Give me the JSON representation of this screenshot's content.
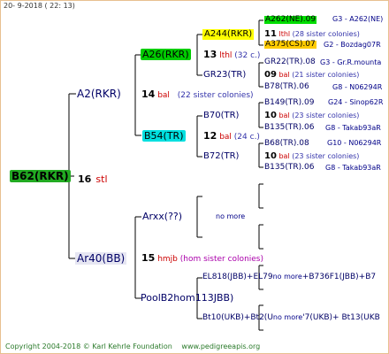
{
  "header": {
    "date": "20-  9-2018 (  22:  13)"
  },
  "footer": {
    "copyright": "Copyright 2004-2018 © Karl Kehrle Foundation",
    "url": "www.pedigreeapis.org"
  },
  "root": {
    "name": "B62(RKR)",
    "num": "16",
    "label": "stl"
  },
  "sire": {
    "name": "A2(RKR)",
    "num": "14",
    "label": "bal",
    "note": "(22 sister colonies)"
  },
  "dam": {
    "name": "Ar40(BB)",
    "num": "15",
    "label": "hmjb",
    "note": "(hom sister colonies)"
  },
  "s_a26": {
    "name": "A26(RKR)",
    "num": "13",
    "label": "lthl",
    "note": "(32 c.)"
  },
  "s_b54": {
    "name": "B54(TR)",
    "num": "12",
    "label": "bal",
    "note": "(24 c.)"
  },
  "d_arxx": {
    "name": "Arxx(??)",
    "note": "no more"
  },
  "d_pool": {
    "name": "PoolB2hom113JBB)"
  },
  "a244": {
    "name": "A244(RKR)",
    "num": "11",
    "label": "lthl",
    "note": "(28 sister colonies)"
  },
  "gr23": {
    "name": "GR23(TR)",
    "num": "09",
    "label": "bal",
    "note": "(21 sister colonies)"
  },
  "b70": {
    "name": "B70(TR)",
    "num": "10",
    "label": "bal",
    "note": "(23 sister colonies)"
  },
  "b72": {
    "name": "B72(TR)",
    "num": "10",
    "label": "bal",
    "note": "(23 sister colonies)"
  },
  "g5": [
    {
      "name": "A262(NE).09",
      "info": "G3 - A262(NE)"
    },
    {
      "name": "A375(CS).07",
      "info": "G2 - Bozdag07R"
    },
    {
      "name": "GR22(TR).08",
      "info": "G3 - Gr.R.mounta"
    },
    {
      "name": "B78(TR).06",
      "info": "G8 - N06294R"
    },
    {
      "name": "B149(TR).09",
      "info": "G24 - Sinop62R"
    },
    {
      "name": "B135(TR).06",
      "info": "G8 - Takab93aR"
    },
    {
      "name": "B68(TR).08",
      "info": "G10 - N06294R"
    },
    {
      "name": "B135(TR).06",
      "info": "G8 - Takab93aR"
    }
  ],
  "pool_lines": {
    "l1": "EL818(JBB)+EL79",
    "l1b": "no more",
    "l1c": "+B736F1(JBB)+B7",
    "l2": "Bt10(UKB)+Bt2(U",
    "l2b": "no more",
    "l2c": "'7(UKB)+ Bt13(UKB"
  }
}
